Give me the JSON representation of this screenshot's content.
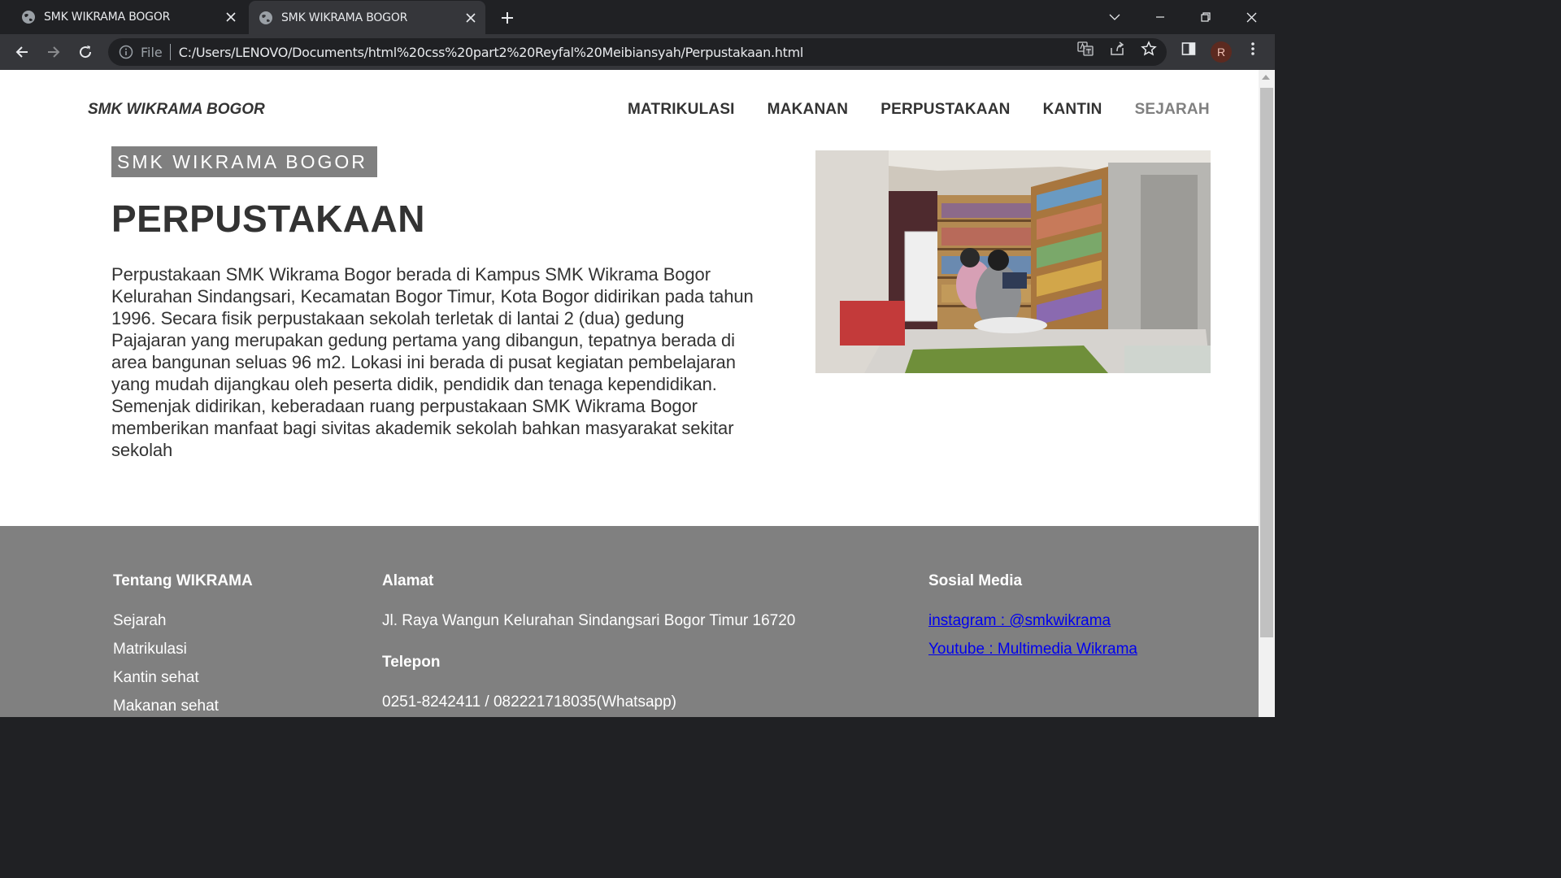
{
  "browser": {
    "tabs": [
      {
        "title": "SMK WIKRAMA BOGOR",
        "active": false
      },
      {
        "title": "SMK WIKRAMA BOGOR",
        "active": true
      }
    ],
    "address": {
      "scheme_label": "File",
      "url": "C:/Users/LENOVO/Documents/html%20css%20part2%20Reyfal%20Meibiansyah/Perpustakaan.html"
    },
    "profile_initial": "R"
  },
  "header": {
    "brand": "SMK WIKRAMA BOGOR",
    "nav": [
      "MATRIKULASI",
      "MAKANAN",
      "PERPUSTAKAAN",
      "KANTIN",
      "SEJARAH"
    ]
  },
  "main": {
    "badge": "SMK WIKRAMA BOGOR",
    "title": "PERPUSTAKAAN",
    "description": "Perpustakaan SMK Wikrama Bogor berada di Kampus SMK Wikrama Bogor Kelurahan Sindangsari, Kecamatan Bogor Timur, Kota Bogor didirikan pada tahun 1996. Secara fisik perpustakaan sekolah terletak di lantai 2 (dua) gedung Pajajaran yang merupakan gedung pertama yang dibangun, tepatnya berada di area bangunan seluas 96 m2. Lokasi ini berada di pusat kegiatan pembelajaran yang mudah dijangkau oleh peserta didik, pendidik dan tenaga kependidikan. Semenjak didirikan, keberadaan ruang perpustakaan SMK Wikrama Bogor memberikan manfaat bagi sivitas akademik sekolah bahkan masyarakat sekitar sekolah"
  },
  "footer": {
    "about": {
      "heading": "Tentang WIKRAMA",
      "items": [
        "Sejarah",
        "Matrikulasi",
        "Kantin sehat",
        "Makanan sehat"
      ]
    },
    "address": {
      "heading": "Alamat",
      "text": "Jl. Raya Wangun Kelurahan Sindangsari Bogor Timur 16720",
      "phone_heading": "Telepon",
      "phone": "0251-8242411 / 082221718035(Whatsapp)"
    },
    "social": {
      "heading": "Sosial Media",
      "links": [
        "instagram : @smkwikrama",
        "Youtube : Multimedia Wikrama"
      ]
    }
  },
  "colors": {
    "chrome_dark": "#202124",
    "chrome_toolbar": "#35363a",
    "accent_gray": "#808080",
    "text_dark": "#333333",
    "link_blue": "#0000ee"
  }
}
